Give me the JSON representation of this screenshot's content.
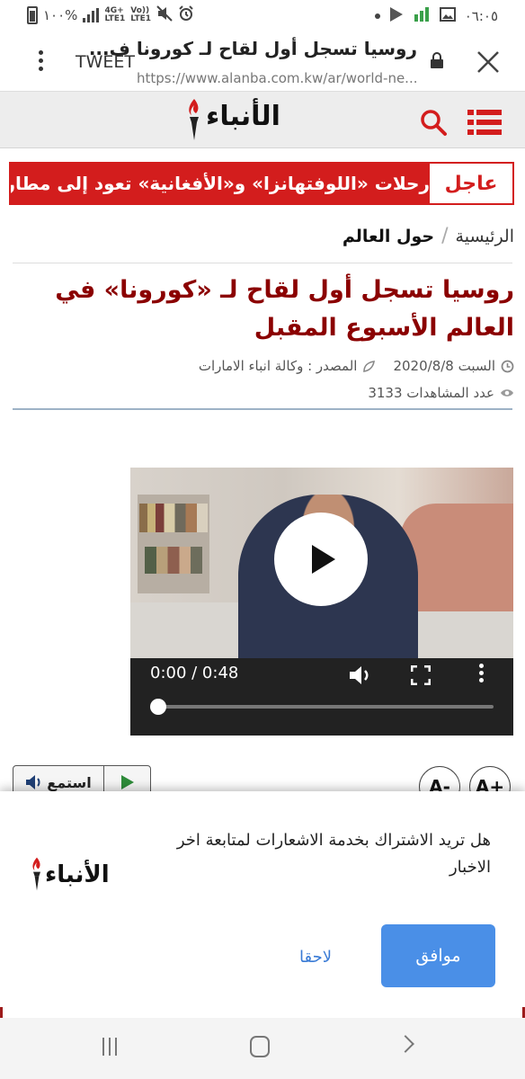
{
  "status": {
    "battery_text": "١٠٠%",
    "net_top": "4G+",
    "net_bottom": "LTE1",
    "volte_top": "Vo))",
    "volte_bottom": "LTE1",
    "clock": "٠٦:٠٥"
  },
  "browser": {
    "page_title": "روسيا تسجل أول لقاح لـ كورونا ف...",
    "tweet_label": "TWEET",
    "url": "https://www.alanba.com.kw/ar/world-ne..."
  },
  "site": {
    "logo_text": "الأنباء",
    "accent_color": "#d31d1d"
  },
  "breaking": {
    "tag": "عاجل",
    "text": "رحلات «اللوفتهانزا» و«الأفغانية» تعود إلى مطار"
  },
  "breadcrumb": {
    "home": "الرئيسية",
    "separator": "/",
    "current": "حول العالم"
  },
  "article": {
    "title": "روسيا تسجل أول لقاح لـ «كورونا» في العالم الأسبوع المقبل",
    "date": "السبت  2020/8/8",
    "source": "المصدر : وكالة انباء الامارات",
    "views": "عدد المشاهدات 3133"
  },
  "video": {
    "time": "0:00 / 0:48",
    "progress": 0
  },
  "controls": {
    "listen_label": "استمع",
    "font_decrease": "A-",
    "font_increase": "A+"
  },
  "notification": {
    "message": "هل تريد الاشتراك بخدمة الاشعارات لمتابعة اخر الاخبار",
    "logo_text": "الأنباء",
    "later_label": "لاحقا",
    "accept_label": "موافق",
    "accept_color": "#4a8fe7"
  }
}
